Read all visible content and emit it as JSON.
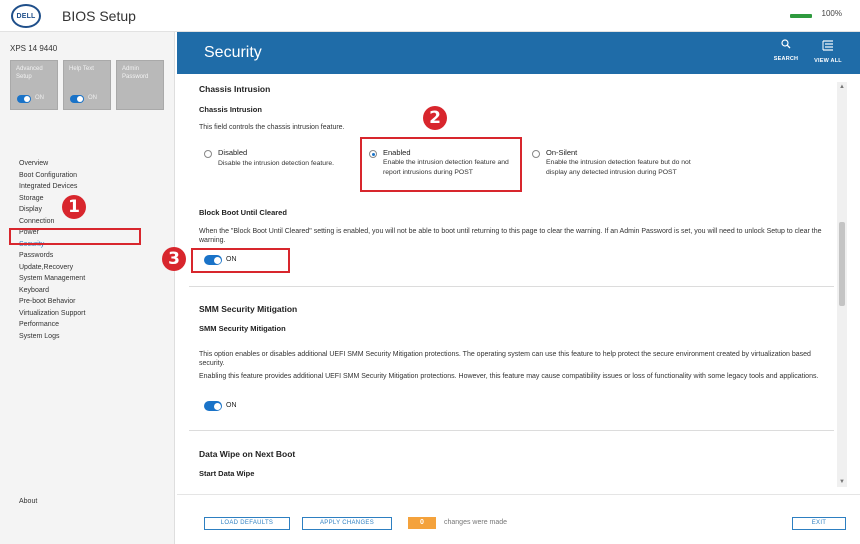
{
  "app": {
    "logo": "DELL",
    "title": "BIOS Setup",
    "battery": "100%"
  },
  "sidebar": {
    "device": "XPS 14 9440",
    "modes": [
      {
        "label": "Advanced Setup",
        "toggle": "ON"
      },
      {
        "label": "Help Text",
        "toggle": "ON"
      },
      {
        "label": "Admin Password",
        "toggle": ""
      }
    ],
    "items": [
      {
        "label": "Overview"
      },
      {
        "label": "Boot Configuration"
      },
      {
        "label": "Integrated Devices"
      },
      {
        "label": "Storage"
      },
      {
        "label": "Display"
      },
      {
        "label": "Connection"
      },
      {
        "label": "Power"
      },
      {
        "label": "Security"
      },
      {
        "label": "Passwords"
      },
      {
        "label": "Update,Recovery"
      },
      {
        "label": "System Management"
      },
      {
        "label": "Keyboard"
      },
      {
        "label": "Pre-boot Behavior"
      },
      {
        "label": "Virtualization Support"
      },
      {
        "label": "Performance"
      },
      {
        "label": "System Logs"
      }
    ],
    "active": "Security",
    "about": "About"
  },
  "header": {
    "title": "Security",
    "search_label": "SEARCH",
    "view_all_label": "VIEW ALL",
    "search_icon": "search-icon",
    "view_all_icon": "view-all-icon"
  },
  "chassis": {
    "section_title": "Chassis Intrusion",
    "setting_title": "Chassis Intrusion",
    "description": "This field controls the chassis intrusion feature.",
    "options": [
      {
        "label": "Disabled",
        "desc": "Disable the intrusion detection feature.",
        "selected": false
      },
      {
        "label": "Enabled",
        "desc": "Enable the intrusion detection feature and report intrusions during POST",
        "selected": true
      },
      {
        "label": "On-Silent",
        "desc": "Enable the intrusion detection feature but do not display any detected intrusion during POST",
        "selected": false
      }
    ]
  },
  "block_boot": {
    "title": "Block Boot Until Cleared",
    "description": "When the \"Block Boot Until Cleared\" setting is enabled, you will not be able to boot until returning to this page to clear the warning. If an Admin Password is set, you will need to unlock Setup to clear the warning.",
    "toggle": "ON"
  },
  "smm": {
    "section_title": "SMM Security Mitigation",
    "setting_title": "SMM Security Mitigation",
    "description1": "This option enables or disables additional UEFI SMM Security Mitigation protections. The operating system can use this feature to help protect the secure environment created by virtualization based security.",
    "description2": "Enabling this feature provides additional UEFI SMM Security Mitigation protections. However, this feature may cause compatibility issues or loss of functionality with some legacy tools and applications.",
    "toggle": "ON"
  },
  "data_wipe": {
    "section_title": "Data Wipe on Next Boot",
    "setting_title": "Start Data Wipe"
  },
  "annotations": [
    "1",
    "2",
    "3"
  ],
  "footer": {
    "load_defaults": "LOAD DEFAULTS",
    "apply_changes": "APPLY CHANGES",
    "changes_count": "0",
    "changes_text": "changes were made",
    "exit": "EXIT"
  },
  "colors": {
    "header": "#1f6ca8",
    "accent": "#1a73c8",
    "annotation": "#d8262d",
    "changes_badge": "#f4a23c"
  }
}
